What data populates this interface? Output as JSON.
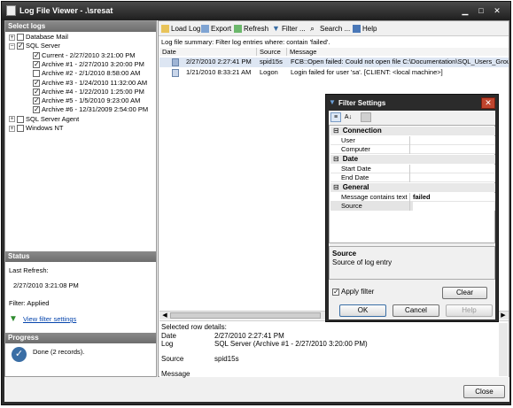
{
  "window": {
    "title": "Log File Viewer - .\\sresat"
  },
  "left_panel": {
    "select_logs_header": "Select logs",
    "tree": [
      {
        "label": "Database Mail",
        "level": 0,
        "expander": "+",
        "checked": false
      },
      {
        "label": "SQL Server",
        "level": 0,
        "expander": "−",
        "checked": true
      },
      {
        "label": "Current - 2/27/2010 3:21:00 PM",
        "level": 1,
        "checked": true
      },
      {
        "label": "Archive #1 - 2/27/2010 3:20:00 PM",
        "level": 1,
        "checked": true
      },
      {
        "label": "Archive #2 - 2/1/2010 8:58:00 AM",
        "level": 1,
        "checked": false
      },
      {
        "label": "Archive #3 - 1/24/2010 11:32:00 AM",
        "level": 1,
        "checked": true
      },
      {
        "label": "Archive #4 - 1/22/2010 1:25:00 PM",
        "level": 1,
        "checked": true
      },
      {
        "label": "Archive #5 - 1/5/2010 9:23:00 AM",
        "level": 1,
        "checked": true
      },
      {
        "label": "Archive #6 - 12/31/2009 2:54:00 PM",
        "level": 1,
        "checked": true
      },
      {
        "label": "SQL Server Agent",
        "level": 0,
        "expander": "+",
        "checked": false
      },
      {
        "label": "Windows NT",
        "level": 0,
        "expander": "+",
        "checked": false
      }
    ],
    "status_header": "Status",
    "last_refresh_label": "Last Refresh:",
    "last_refresh_value": "2/27/2010 3:21:08 PM",
    "filter_text": "Filter: Applied",
    "view_filter_link": "View filter settings",
    "progress_header": "Progress",
    "progress_text": "Done (2 records)."
  },
  "toolbar": {
    "load_log": "Load Log",
    "export": "Export",
    "refresh": "Refresh",
    "filter": "Filter ...",
    "search": "Search ...",
    "help": "Help"
  },
  "summary": "Log file summary: Filter log entries where: contain 'failed'.",
  "grid": {
    "columns": [
      "Date",
      "Source",
      "Message"
    ],
    "rows": [
      {
        "date": "2/27/2010 2:27:41 PM",
        "source": "spid15s",
        "message": "FCB::Open failed: Could not open file C:\\Documentation\\SQL_Users_Group\\DBA",
        "selected": true
      },
      {
        "date": "1/21/2010 8:33:21 AM",
        "source": "Logon",
        "message": "Login failed for user 'sa'. [CLIENT: <local machine>]",
        "selected": false
      }
    ]
  },
  "details": {
    "header": "Selected row details:",
    "date_label": "Date",
    "date_value": "2/27/2010 2:27:41 PM",
    "log_label": "Log",
    "log_value": "SQL Server (Archive #1 - 2/27/2010 3:20:00 PM)",
    "source_label": "Source",
    "source_value": "spid15s",
    "message_label": "Message"
  },
  "close_button": "Close",
  "filter_dialog": {
    "title": "Filter Settings",
    "categories": {
      "connection": "Connection",
      "date": "Date",
      "general": "General"
    },
    "props": {
      "user": {
        "name": "User",
        "value": ""
      },
      "computer": {
        "name": "Computer",
        "value": ""
      },
      "start_date": {
        "name": "Start Date",
        "value": ""
      },
      "end_date": {
        "name": "End Date",
        "value": ""
      },
      "message_contains": {
        "name": "Message contains text",
        "value": "failed"
      },
      "source": {
        "name": "Source",
        "value": ""
      }
    },
    "desc_title": "Source",
    "desc_text": "Source of log entry",
    "apply_filter_label": "Apply filter",
    "apply_filter_checked": true,
    "clear_button": "Clear",
    "ok_button": "OK",
    "cancel_button": "Cancel",
    "help_button": "Help"
  },
  "colors": {
    "accent": "#3a6ea5",
    "selected_row": "#dde6f3",
    "link": "#0645ad"
  }
}
